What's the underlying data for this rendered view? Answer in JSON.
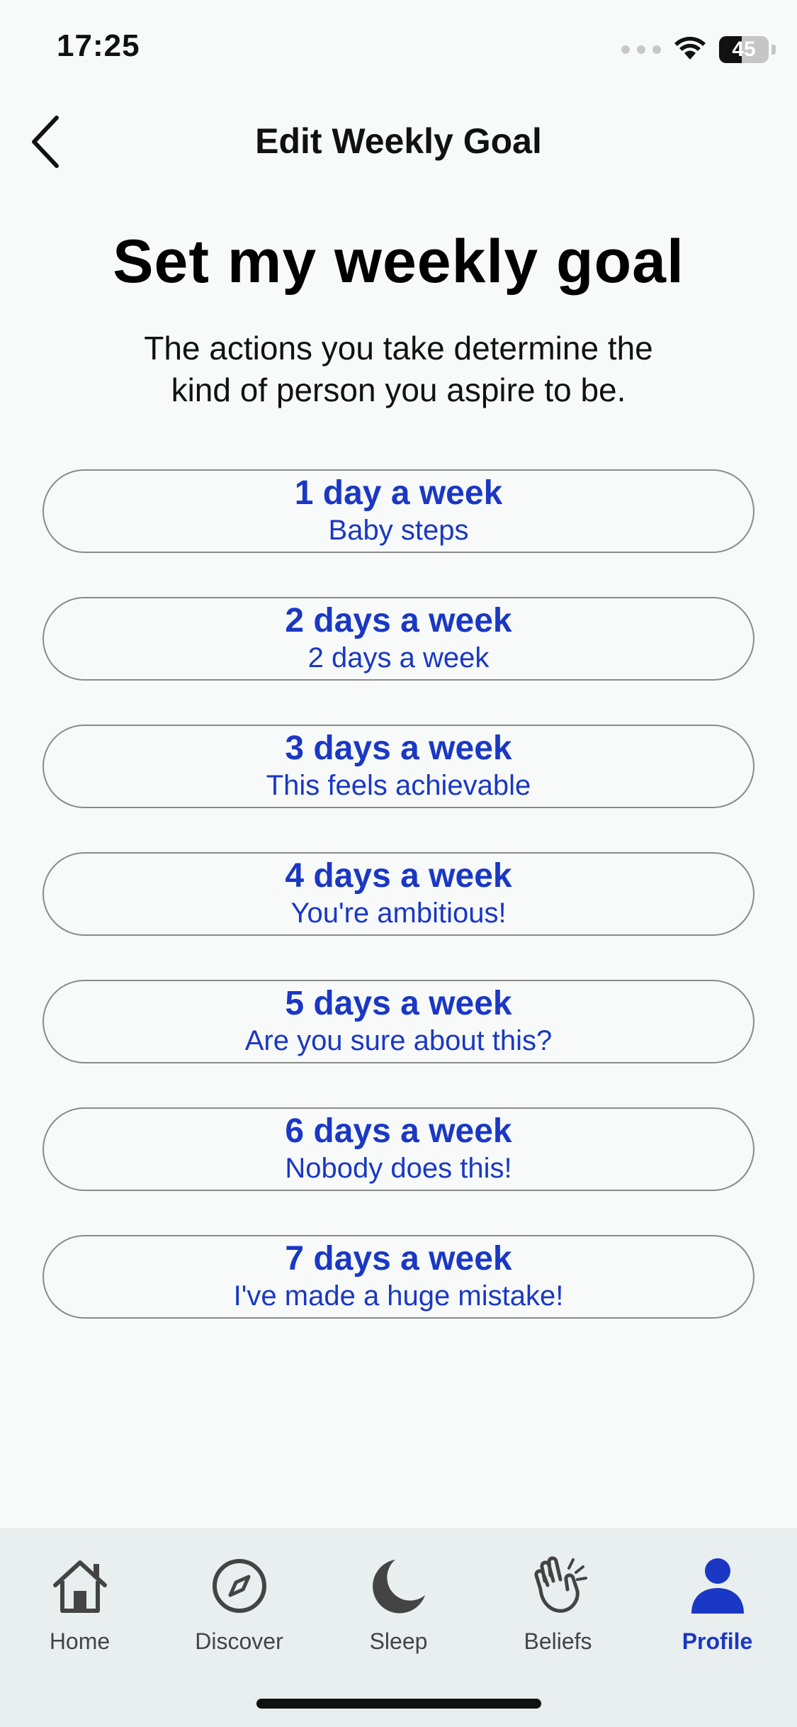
{
  "status_bar": {
    "time": "17:25",
    "battery_percent": "45",
    "battery_level": 0.45
  },
  "nav": {
    "title": "Edit Weekly Goal"
  },
  "page": {
    "heading": "Set my weekly goal",
    "subtext": "The actions you take determine the kind of person you aspire to be."
  },
  "options": [
    {
      "title": "1 day a week",
      "subtitle": "Baby steps"
    },
    {
      "title": "2 days a week",
      "subtitle": "2 days a week"
    },
    {
      "title": "3 days a week",
      "subtitle": "This feels achievable"
    },
    {
      "title": "4 days a week",
      "subtitle": "You're ambitious!"
    },
    {
      "title": "5 days a week",
      "subtitle": "Are you sure about this?"
    },
    {
      "title": "6 days a week",
      "subtitle": "Nobody does this!"
    },
    {
      "title": "7 days a week",
      "subtitle": "I've made a huge mistake!"
    }
  ],
  "tab_bar": {
    "items": [
      {
        "label": "Home",
        "icon": "home-icon",
        "active": false
      },
      {
        "label": "Discover",
        "icon": "compass-icon",
        "active": false
      },
      {
        "label": "Sleep",
        "icon": "moon-icon",
        "active": false
      },
      {
        "label": "Beliefs",
        "icon": "clapping-hands-icon",
        "active": false
      },
      {
        "label": "Profile",
        "icon": "person-icon",
        "active": true
      }
    ]
  },
  "colors": {
    "accent": "#1a38c4",
    "background": "#f8fafa",
    "tab_bar_background": "#e9eeee",
    "option_border": "#8a8a8a"
  }
}
